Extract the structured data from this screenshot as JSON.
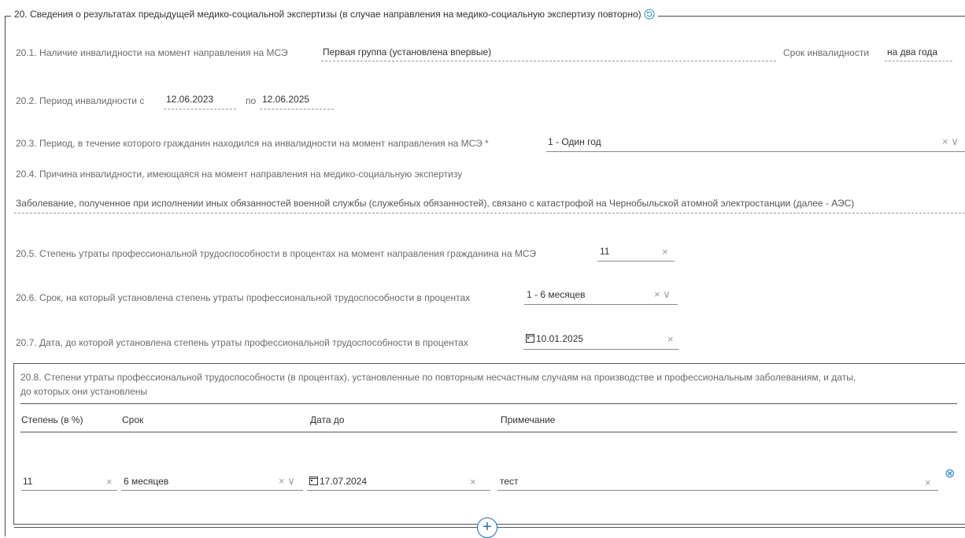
{
  "section": {
    "title": "20. Сведения о результатах предыдущей медико-социальной экспертизы (в случае направления на медико-социальную экспертизу повторно)"
  },
  "f20_1": {
    "label": "20.1. Наличие инвалидности на момент направления на МСЭ",
    "value": "Первая группа (установлена впервые)",
    "term_label": "Срок инвалидности",
    "term_value": "на два года"
  },
  "f20_2": {
    "label": "20.2. Период инвалидности с",
    "from": "12.06.2023",
    "to_label": "по",
    "to": "12.06.2025"
  },
  "f20_3": {
    "label": "20.3. Период, в течение которого гражданин находился на инвалидности на момент направления на МСЭ *",
    "value": "1 - Один год"
  },
  "f20_4": {
    "label": "20.4. Причина инвалидности, имеющаяся на момент направления на медико-социальную экспертизу",
    "value": "Заболевание, полученное при исполнении иных обязанностей военной службы (служебных обязанностей), связано с катастрофой на Чернобыльской атомной электростанции (далее - АЭС)"
  },
  "f20_5": {
    "label": "20.5. Степень утраты профессиональной трудоспособности в процентах на момент направления гражданина на МСЭ",
    "value": "11"
  },
  "f20_6": {
    "label": "20.6. Срок, на который установлена степень утраты профессиональной трудоспособности в процентах",
    "value": "1 - 6 месяцев"
  },
  "f20_7": {
    "label": "20.7. Дата, до которой установлена степень утраты профессиональной трудоспособности в процентах",
    "value": "10.01.2025"
  },
  "f20_8": {
    "title_line1": "20.8. Степени утраты профессиональной трудоспособности (в процентах), установленные по повторным несчастным случаям на производстве и профессиональным заболеваниям, и даты,",
    "title_line2": "до которых они установлены",
    "columns": [
      "Степень (в %)",
      "Срок",
      "Дата до",
      "Примечание"
    ],
    "rows": [
      {
        "degree": "11",
        "term": "6 месяцев",
        "date": "17.07.2024",
        "note": "тест"
      }
    ]
  },
  "icons": {
    "clear": "×",
    "chevron": "∨",
    "remove": "⊗",
    "add": "+"
  },
  "colors": {
    "accent": "#1e6fae",
    "remove": "#2a8bcc"
  }
}
